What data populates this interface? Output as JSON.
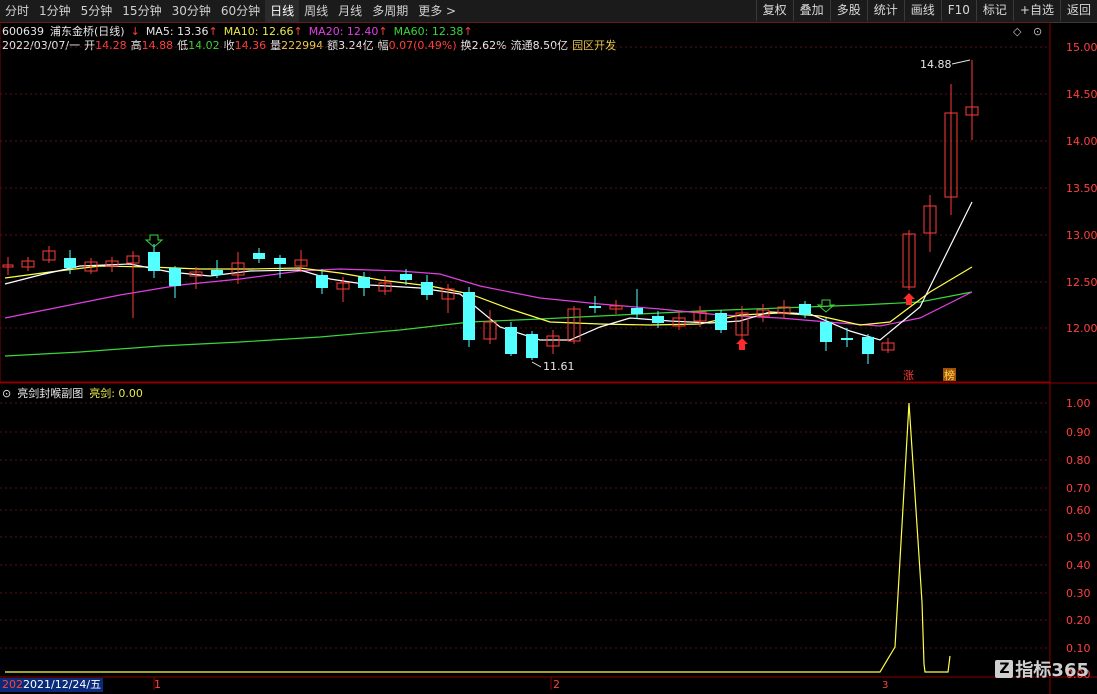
{
  "toolbar": {
    "periods": [
      "分时",
      "1分钟",
      "5分钟",
      "15分钟",
      "30分钟",
      "60分钟",
      "日线",
      "周线",
      "月线",
      "多周期",
      "更多 >"
    ],
    "active_period": "日线",
    "buttons": [
      "复权",
      "叠加",
      "多股",
      "统计",
      "画线",
      "F10",
      "标记",
      "+自选",
      "返回"
    ]
  },
  "stock": {
    "code": "600639",
    "name": "浦东金桥",
    "period_label": "(日线)",
    "ma5_label": "MA5: 13.36",
    "ma10_label": "MA10: 12.66",
    "ma20_label": "MA20: 12.40",
    "ma60_label": "MA60: 12.38",
    "date": "2022/03/07/一",
    "open_label": "开",
    "open": "14.28",
    "high_label": "高",
    "high": "14.88",
    "low_label": "低",
    "low": "14.02",
    "close_label": "收",
    "close": "14.36",
    "volume_label": "量",
    "volume": "222994",
    "amount_label": "额",
    "amount": "3.24亿",
    "change_label": "幅",
    "change": "0.07(0.49%)",
    "turnover_label": "换",
    "turnover": "2.62%",
    "float_label": "流通",
    "float": "8.50亿",
    "sector": "园区开发"
  },
  "main_chart": {
    "y_ticks": [
      "15.00",
      "14.50",
      "14.00",
      "13.50",
      "13.00",
      "12.50",
      "12.00"
    ],
    "high_annotation": "14.88",
    "low_annotation": "11.61",
    "tag_zhang": "涨",
    "tag_bang": "榜",
    "colors": {
      "up": "#ff3b3b",
      "down": "#54ffff",
      "ma5": "#ffffff",
      "ma10": "#ffff4a",
      "ma20": "#e040e0",
      "ma60": "#3ad63a"
    }
  },
  "sub_chart": {
    "title": "亮剑封喉副图",
    "indicator_label": "亮剑: 0.00",
    "y_ticks": [
      "1.00",
      "0.90",
      "0.80",
      "0.70",
      "0.60",
      "0.50",
      "0.40",
      "0.30",
      "0.20",
      "0.10",
      "0.00"
    ]
  },
  "x_axis": {
    "date_box": "2021/12/24/五",
    "year_prefix": "202",
    "month_1": "1",
    "month_2": "2",
    "month_3": "3"
  },
  "logo": {
    "mark": "Z",
    "text": "指标365"
  }
}
